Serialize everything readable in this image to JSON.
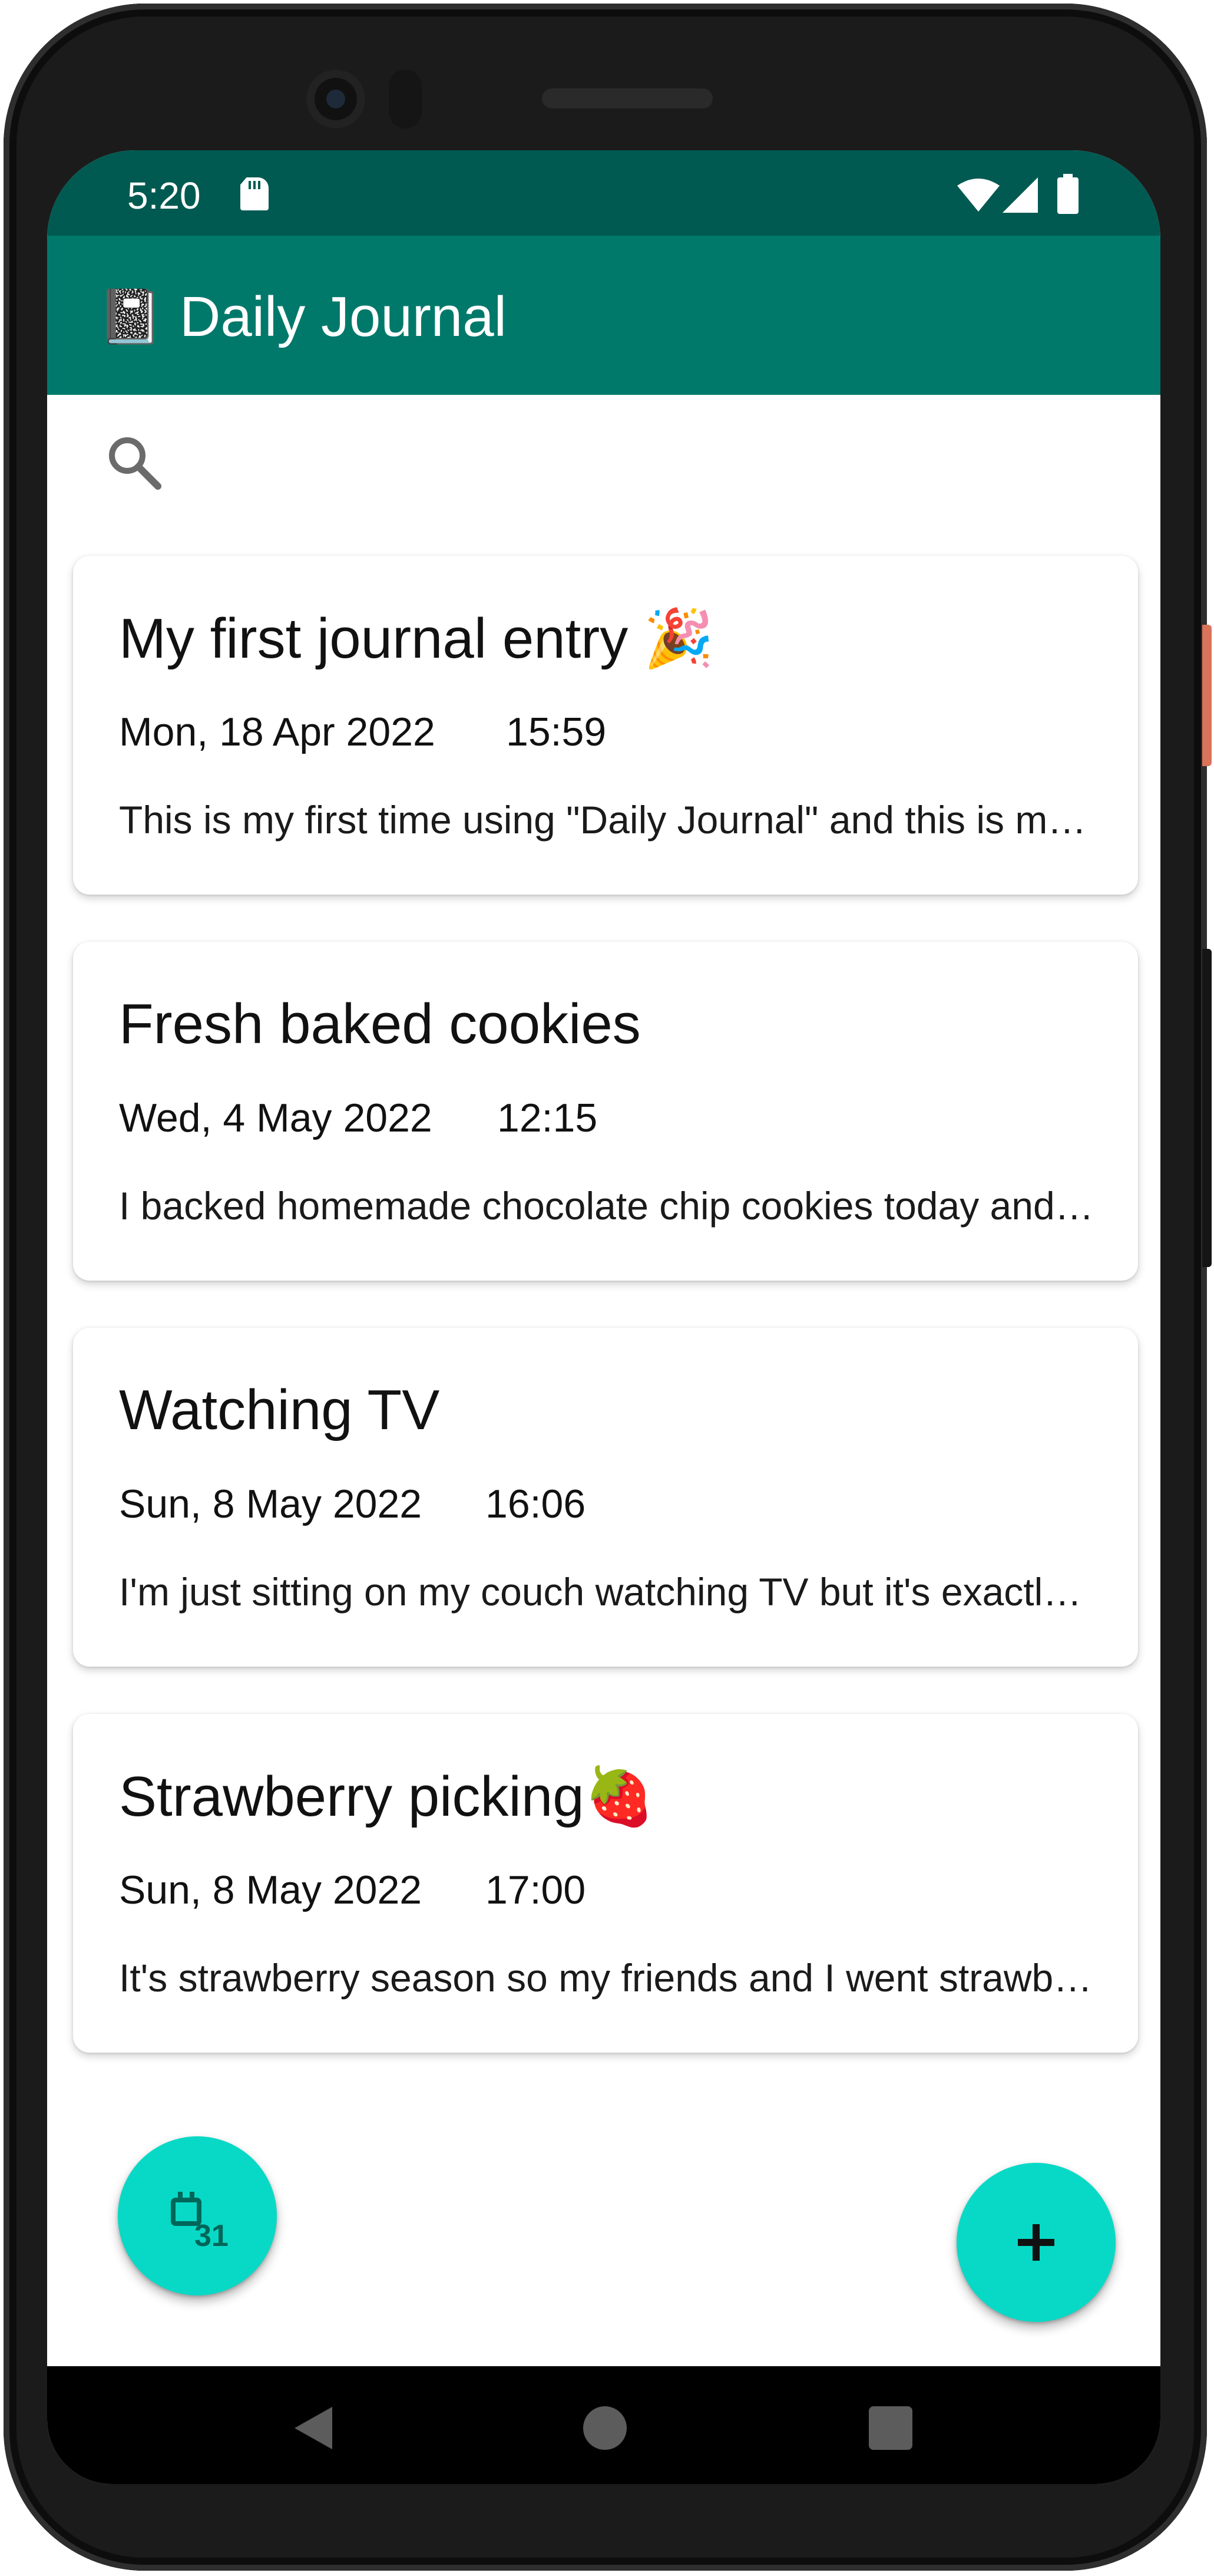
{
  "status_bar": {
    "time": "5:20",
    "icons": [
      "sd-card-icon",
      "wifi-icon",
      "signal-icon",
      "battery-icon"
    ]
  },
  "app_bar": {
    "logo": "📓",
    "title": "Daily Journal"
  },
  "search": {
    "icon": "search-icon"
  },
  "entries": [
    {
      "title": "My first journal entry 🎉",
      "date": "Mon, 18 Apr 2022",
      "time": "15:59",
      "preview": "This is my first time using \"Daily Journal\" and this is my first journal entry."
    },
    {
      "title": "Fresh baked cookies",
      "date": "Wed, 4 May 2022",
      "time": "12:15",
      "preview": "I backed homemade chocolate chip cookies today and they turned out delicious."
    },
    {
      "title": "Watching TV",
      "date": "Sun, 8 May 2022",
      "time": "16:06",
      "preview": "I'm just sitting on my couch watching TV but it's exactly what I needed today."
    },
    {
      "title": "Strawberry picking🍓",
      "date": "Sun, 8 May 2022",
      "time": "17:00",
      "preview": "It's strawberry season so my friends and I went strawberry picking at the farm."
    }
  ],
  "fabs": {
    "calendar_icon": "calendar-31-icon",
    "add_icon": "add-icon"
  },
  "colors": {
    "status_bar": "#005a51",
    "app_bar": "#00796b",
    "fab": "#08d9c6"
  }
}
